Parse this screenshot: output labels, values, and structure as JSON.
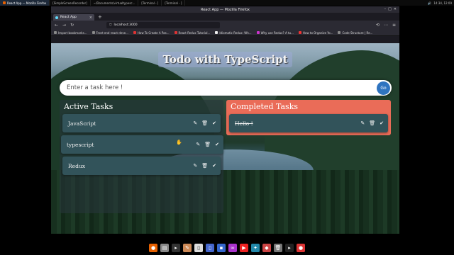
{
  "os_taskbar": {
    "tasks": [
      "React App — Mozilla Firefox",
      "[SimpleScreenRecorder]",
      "~/Documents/virtualtypesc...",
      "[Terminal - ]",
      "[Terminal - ]"
    ],
    "clock": "14:34, 12:09"
  },
  "browser": {
    "window_title": "React App — Mozilla Firefox",
    "tab_title": "React App",
    "url": "localhost:3000",
    "bookmarks": [
      "Import bookmarks...",
      "Front end react deve...",
      "How To Create A Pas...",
      "React Redux Tutorial...",
      "Idiomatic Redux: Wh...",
      "Why use Redux? A tu...",
      "How to Organize Yo...",
      "Code Structure | Re..."
    ]
  },
  "app": {
    "title": "Todo with TypeScript",
    "input_placeholder": "Enter a task here !",
    "go_label": "Go",
    "active_heading": "Active Tasks",
    "completed_heading": "Completed Tasks",
    "active_tasks": [
      "JavaScript",
      "typescript",
      "Redux"
    ],
    "completed_tasks": [
      "Hello !"
    ]
  },
  "colors": {
    "completed_panel": "#ea6c58",
    "task_card": "#32535a",
    "go_button": "#2f74c0"
  }
}
